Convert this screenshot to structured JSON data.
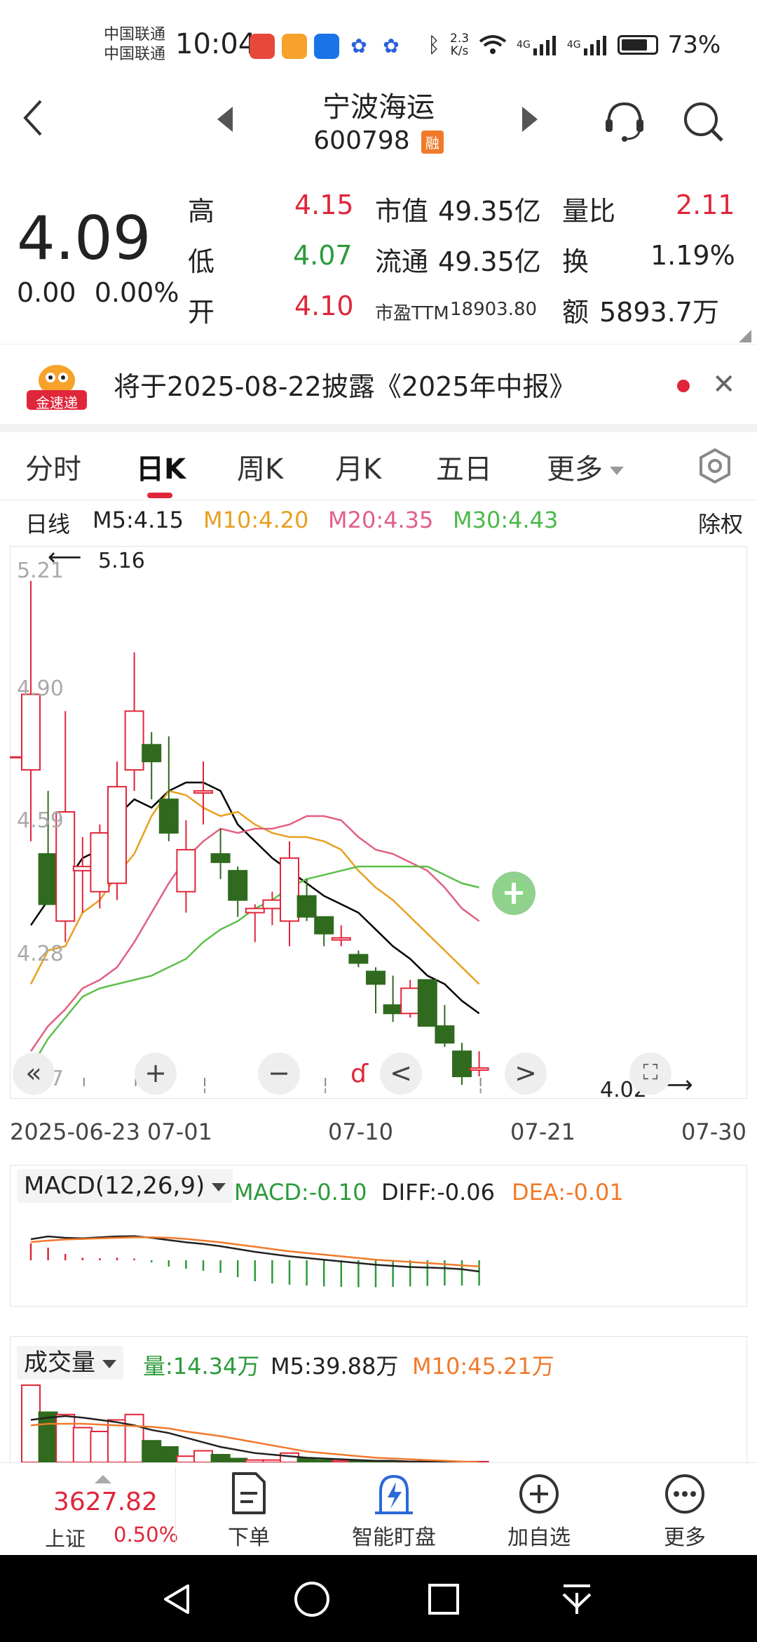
{
  "status_bar": {
    "carrier1": "中国联通",
    "carrier2": "中国联通",
    "time": "10:04",
    "speed_value": "2.3",
    "speed_unit": "K/s",
    "net1": "4G",
    "net2": "4G",
    "battery": "73%"
  },
  "header": {
    "stock_name": "宁波海运",
    "stock_code": "600798",
    "margin_badge": "融"
  },
  "quote": {
    "price": "4.09",
    "change": "0.00",
    "change_pct": "0.00%",
    "rows": [
      {
        "l1": "高",
        "v1": "4.15",
        "l2": "市值",
        "v2": "49.35亿",
        "l3": "量比",
        "v3": "2.11"
      },
      {
        "l1": "低",
        "v1": "4.07",
        "l2": "流通",
        "v2": "49.35亿",
        "l3": "换",
        "v3": "1.19%"
      },
      {
        "l1": "开",
        "v1": "4.10",
        "l2": "市盈TTM",
        "v2": "18903.80",
        "l3": "额",
        "v3": "5893.7万"
      }
    ]
  },
  "banner": {
    "logo_text": "金速递",
    "text": "将于2025-08-22披露《2025年中报》"
  },
  "tabs": [
    "分时",
    "日K",
    "周K",
    "月K",
    "五日",
    "更多"
  ],
  "active_tab": "日K",
  "ma_legend": {
    "period": "日线",
    "m5": "M5:4.15",
    "m10": "M10:4.20",
    "m20": "M20:4.35",
    "m30": "M30:4.43",
    "adjust": "除权"
  },
  "colors": {
    "up": "#e0263a",
    "down": "#2f6a1e",
    "m5": "#000000",
    "m10": "#e8a020",
    "m20": "#e26080",
    "m30": "#5cc04a"
  },
  "chart_data": {
    "type": "candlestick",
    "y_ticks": [
      "5.21",
      "4.90",
      "4.59",
      "4.28",
      "3.97"
    ],
    "ylim": [
      3.97,
      5.21
    ],
    "high_marker": "5.16",
    "low_marker": "4.02",
    "x_labels": [
      "2025-06-23",
      "07-01",
      "07-10",
      "07-21",
      "07-30"
    ],
    "candles": [
      {
        "o": 4.71,
        "h": 5.16,
        "l": 4.54,
        "c": 4.89
      },
      {
        "o": 4.51,
        "h": 4.66,
        "l": 4.39,
        "c": 4.39
      },
      {
        "o": 4.35,
        "h": 4.85,
        "l": 4.3,
        "c": 4.61
      },
      {
        "o": 4.47,
        "h": 4.55,
        "l": 4.37,
        "c": 4.48
      },
      {
        "o": 4.42,
        "h": 4.58,
        "l": 4.38,
        "c": 4.56
      },
      {
        "o": 4.44,
        "h": 4.73,
        "l": 4.4,
        "c": 4.67
      },
      {
        "o": 4.71,
        "h": 4.99,
        "l": 4.66,
        "c": 4.85
      },
      {
        "o": 4.77,
        "h": 4.8,
        "l": 4.64,
        "c": 4.73
      },
      {
        "o": 4.64,
        "h": 4.79,
        "l": 4.54,
        "c": 4.56
      },
      {
        "o": 4.42,
        "h": 4.59,
        "l": 4.37,
        "c": 4.52
      },
      {
        "o": 4.66,
        "h": 4.73,
        "l": 4.58,
        "c": 4.66
      },
      {
        "o": 4.51,
        "h": 4.57,
        "l": 4.45,
        "c": 4.49
      },
      {
        "o": 4.47,
        "h": 4.48,
        "l": 4.36,
        "c": 4.4
      },
      {
        "o": 4.37,
        "h": 4.39,
        "l": 4.3,
        "c": 4.38
      },
      {
        "o": 4.38,
        "h": 4.42,
        "l": 4.34,
        "c": 4.4
      },
      {
        "o": 4.35,
        "h": 4.54,
        "l": 4.29,
        "c": 4.5
      },
      {
        "o": 4.41,
        "h": 4.45,
        "l": 4.35,
        "c": 4.36
      },
      {
        "o": 4.36,
        "h": 4.36,
        "l": 4.29,
        "c": 4.32
      },
      {
        "o": 4.31,
        "h": 4.34,
        "l": 4.29,
        "c": 4.31
      },
      {
        "o": 4.27,
        "h": 4.28,
        "l": 4.24,
        "c": 4.25
      },
      {
        "o": 4.23,
        "h": 4.24,
        "l": 4.13,
        "c": 4.2
      },
      {
        "o": 4.15,
        "h": 4.22,
        "l": 4.11,
        "c": 4.13
      },
      {
        "o": 4.13,
        "h": 4.21,
        "l": 4.12,
        "c": 4.19
      },
      {
        "o": 4.21,
        "h": 4.21,
        "l": 4.1,
        "c": 4.1
      },
      {
        "o": 4.1,
        "h": 4.15,
        "l": 4.05,
        "c": 4.06
      },
      {
        "o": 4.04,
        "h": 4.06,
        "l": 3.96,
        "c": 3.98
      },
      {
        "o": 4.0,
        "h": 4.04,
        "l": 3.98,
        "c": 4.0
      }
    ],
    "ma_series": [
      {
        "name": "M5",
        "values": [
          4.34,
          4.4,
          4.44,
          4.5,
          4.52,
          4.6,
          4.64,
          4.62,
          4.66,
          4.68,
          4.68,
          4.66,
          4.58,
          4.54,
          4.5,
          4.47,
          4.44,
          4.41,
          4.39,
          4.37,
          4.33,
          4.29,
          4.26,
          4.22,
          4.2,
          4.16,
          4.13
        ]
      },
      {
        "name": "M10",
        "values": [
          4.2,
          4.28,
          4.29,
          4.37,
          4.4,
          4.46,
          4.51,
          4.6,
          4.66,
          4.65,
          4.62,
          4.6,
          4.61,
          4.58,
          4.56,
          4.55,
          4.55,
          4.54,
          4.52,
          4.47,
          4.43,
          4.4,
          4.36,
          4.32,
          4.28,
          4.24,
          4.2
        ]
      },
      {
        "name": "M20",
        "values": [
          4.04,
          4.1,
          4.14,
          4.19,
          4.21,
          4.24,
          4.3,
          4.37,
          4.44,
          4.5,
          4.54,
          4.57,
          4.56,
          4.57,
          4.57,
          4.58,
          4.6,
          4.6,
          4.59,
          4.55,
          4.52,
          4.51,
          4.49,
          4.47,
          4.43,
          4.38,
          4.35
        ]
      },
      {
        "name": "M30",
        "values": [
          4.0,
          4.07,
          4.12,
          4.17,
          4.19,
          4.2,
          4.21,
          4.22,
          4.24,
          4.26,
          4.3,
          4.33,
          4.35,
          4.38,
          4.4,
          4.43,
          4.45,
          4.46,
          4.47,
          4.48,
          4.48,
          4.48,
          4.48,
          4.48,
          4.46,
          4.44,
          4.43
        ]
      }
    ]
  },
  "chart_controls": [
    "«",
    "+",
    "−",
    "<",
    ">"
  ],
  "macd": {
    "label": "MACD(12,26,9)",
    "macd": "MACD:-0.10",
    "diff": "DIFF:-0.06",
    "dea": "DEA:-0.01",
    "diff_values": [
      0.055,
      0.065,
      0.06,
      0.058,
      0.062,
      0.065,
      0.066,
      0.06,
      0.052,
      0.044,
      0.038,
      0.03,
      0.02,
      0.01,
      0.002,
      -0.006,
      -0.012,
      -0.018,
      -0.024,
      -0.03,
      -0.036,
      -0.04,
      -0.044,
      -0.046,
      -0.048,
      -0.052,
      -0.06
    ],
    "dea_values": [
      0.045,
      0.05,
      0.054,
      0.056,
      0.058,
      0.06,
      0.062,
      0.062,
      0.06,
      0.056,
      0.05,
      0.044,
      0.036,
      0.028,
      0.02,
      0.012,
      0.006,
      0.0,
      -0.006,
      -0.012,
      -0.018,
      -0.022,
      -0.026,
      -0.03,
      -0.034,
      -0.038,
      -0.042
    ],
    "bars": [
      0.04,
      0.03,
      0.015,
      0.006,
      0.005,
      0.006,
      0.004,
      -0.005,
      -0.015,
      -0.02,
      -0.025,
      -0.03,
      -0.04,
      -0.05,
      -0.055,
      -0.058,
      -0.06,
      -0.062,
      -0.063,
      -0.064,
      -0.064,
      -0.063,
      -0.062,
      -0.061,
      -0.06,
      -0.06,
      -0.06
    ]
  },
  "volume": {
    "label": "成交量",
    "vol": "量:14.34万",
    "m5": "M5:39.88万",
    "m10": "M10:45.21万"
  },
  "bottom_bar": {
    "index_value": "3627.82",
    "index_name": "上证",
    "index_pct": "0.50%",
    "buttons": [
      "下单",
      "智能盯盘",
      "加自选",
      "更多"
    ]
  }
}
